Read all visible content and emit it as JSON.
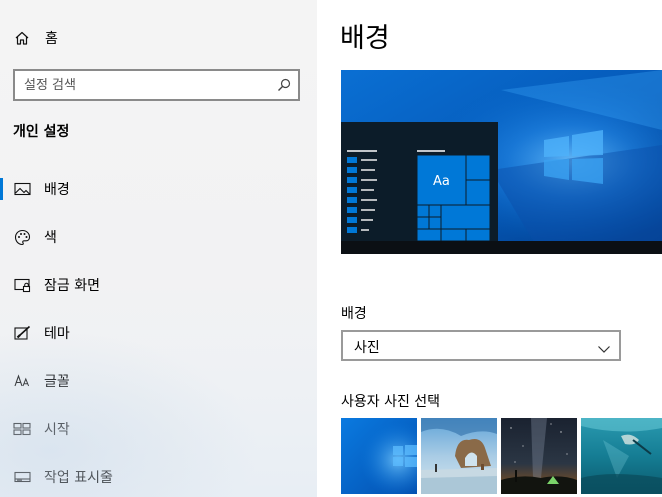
{
  "sidebar": {
    "home_label": "홈",
    "search_placeholder": "설정 검색",
    "section_title": "개인 설정",
    "items": [
      {
        "label": "배경",
        "icon": "picture-icon",
        "active": true
      },
      {
        "label": "색",
        "icon": "palette-icon",
        "active": false
      },
      {
        "label": "잠금 화면",
        "icon": "lock-screen-icon",
        "active": false
      },
      {
        "label": "테마",
        "icon": "theme-brush-icon",
        "active": false
      },
      {
        "label": "글꼴",
        "icon": "font-icon",
        "active": false
      },
      {
        "label": "시작",
        "icon": "start-tiles-icon",
        "active": false
      },
      {
        "label": "작업 표시줄",
        "icon": "taskbar-icon",
        "active": false
      }
    ]
  },
  "main": {
    "title": "배경",
    "preview": {
      "tile_text": "Aa"
    },
    "background_label": "배경",
    "background_select": {
      "value": "사진"
    },
    "choose_label": "사용자 사진 선택",
    "thumbnails": [
      {
        "name": "windows-blue-wallpaper"
      },
      {
        "name": "beach-rock-arch"
      },
      {
        "name": "night-sky-tent"
      },
      {
        "name": "underwater-swimmer"
      }
    ]
  },
  "colors": {
    "accent": "#0078d7",
    "start_panel": "#0c1c29",
    "tile": "#0078d7"
  }
}
